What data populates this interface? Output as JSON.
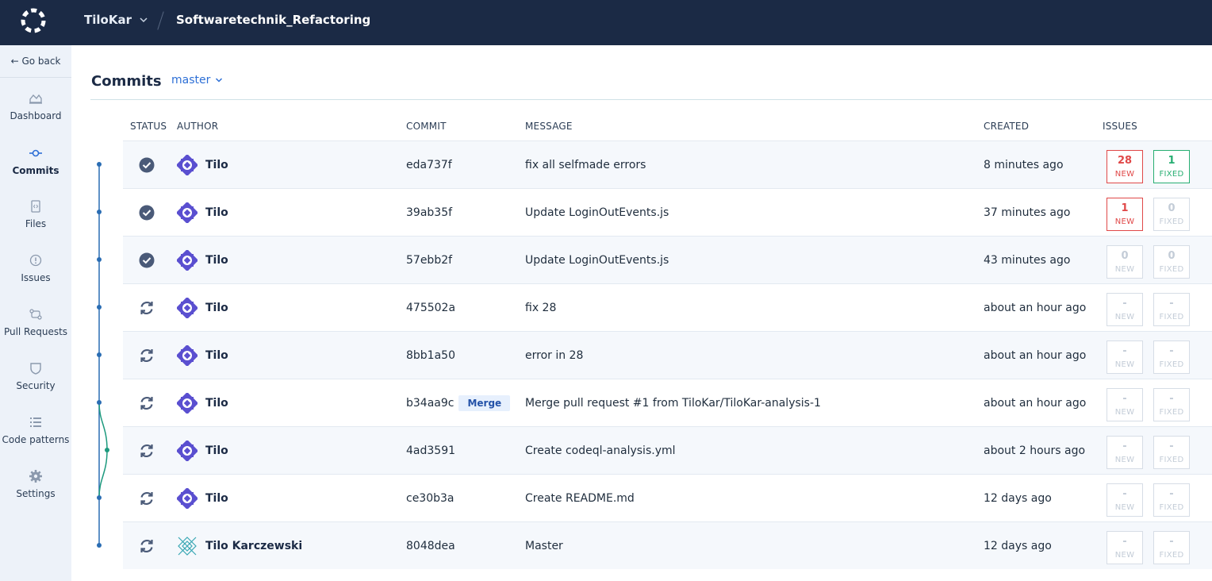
{
  "topbar": {
    "org": "TiloKar",
    "repo": "Softwaretechnik_Refactoring"
  },
  "sidebar": {
    "go_back": "← Go back",
    "items": [
      {
        "label": "Dashboard",
        "icon": "chart-icon"
      },
      {
        "label": "Commits",
        "icon": "commit-icon",
        "active": true
      },
      {
        "label": "Files",
        "icon": "file-icon"
      },
      {
        "label": "Issues",
        "icon": "issue-icon"
      },
      {
        "label": "Pull Requests",
        "icon": "pull-request-icon"
      },
      {
        "label": "Security",
        "icon": "shield-icon"
      },
      {
        "label": "Code patterns",
        "icon": "list-icon"
      },
      {
        "label": "Settings",
        "icon": "gear-icon"
      }
    ]
  },
  "main": {
    "title": "Commits",
    "branch": "master",
    "columns": [
      "STATUS",
      "AUTHOR",
      "COMMIT",
      "MESSAGE",
      "CREATED",
      "ISSUES"
    ],
    "commits": [
      {
        "status": "analyzed",
        "author": "Tilo",
        "sha": "eda737f",
        "tag": "",
        "message": "fix all selfmade errors",
        "created": "8 minutes ago",
        "new": "28",
        "fixed": "1"
      },
      {
        "status": "analyzed",
        "author": "Tilo",
        "sha": "39ab35f",
        "tag": "",
        "message": "Update LoginOutEvents.js",
        "created": "37 minutes ago",
        "new": "1",
        "fixed": "0"
      },
      {
        "status": "analyzed",
        "author": "Tilo",
        "sha": "57ebb2f",
        "tag": "",
        "message": "Update LoginOutEvents.js",
        "created": "43 minutes ago",
        "new": "0",
        "fixed": "0"
      },
      {
        "status": "pending",
        "author": "Tilo",
        "sha": "475502a",
        "tag": "",
        "message": "fix 28",
        "created": "about an hour ago",
        "new": "-",
        "fixed": "-"
      },
      {
        "status": "pending",
        "author": "Tilo",
        "sha": "8bb1a50",
        "tag": "",
        "message": "error in 28",
        "created": "about an hour ago",
        "new": "-",
        "fixed": "-"
      },
      {
        "status": "pending",
        "author": "Tilo",
        "sha": "b34aa9c",
        "tag": "Merge",
        "message": "Merge pull request #1 from TiloKar/TiloKar-analysis-1",
        "created": "about an hour ago",
        "new": "-",
        "fixed": "-"
      },
      {
        "status": "pending",
        "author": "Tilo",
        "sha": "4ad3591",
        "tag": "",
        "message": "Create codeql-analysis.yml",
        "created": "about 2 hours ago",
        "new": "-",
        "fixed": "-"
      },
      {
        "status": "pending",
        "author": "Tilo",
        "sha": "ce30b3a",
        "tag": "",
        "message": "Create README.md",
        "created": "12 days ago",
        "new": "-",
        "fixed": "-"
      },
      {
        "status": "pending",
        "author": "Tilo Karczewski",
        "sha": "8048dea",
        "tag": "",
        "message": "Master",
        "created": "12 days ago",
        "new": "-",
        "fixed": "-"
      }
    ],
    "badge_labels": {
      "new": "NEW",
      "fixed": "FIXED"
    }
  },
  "colors": {
    "topbar": "#1b2a45",
    "sidebar": "#edf2f9",
    "graph_main": "#2a6db3",
    "graph_branch": "#1e9a7e",
    "new_active": "#e04848",
    "fixed_active": "#27ae72"
  }
}
